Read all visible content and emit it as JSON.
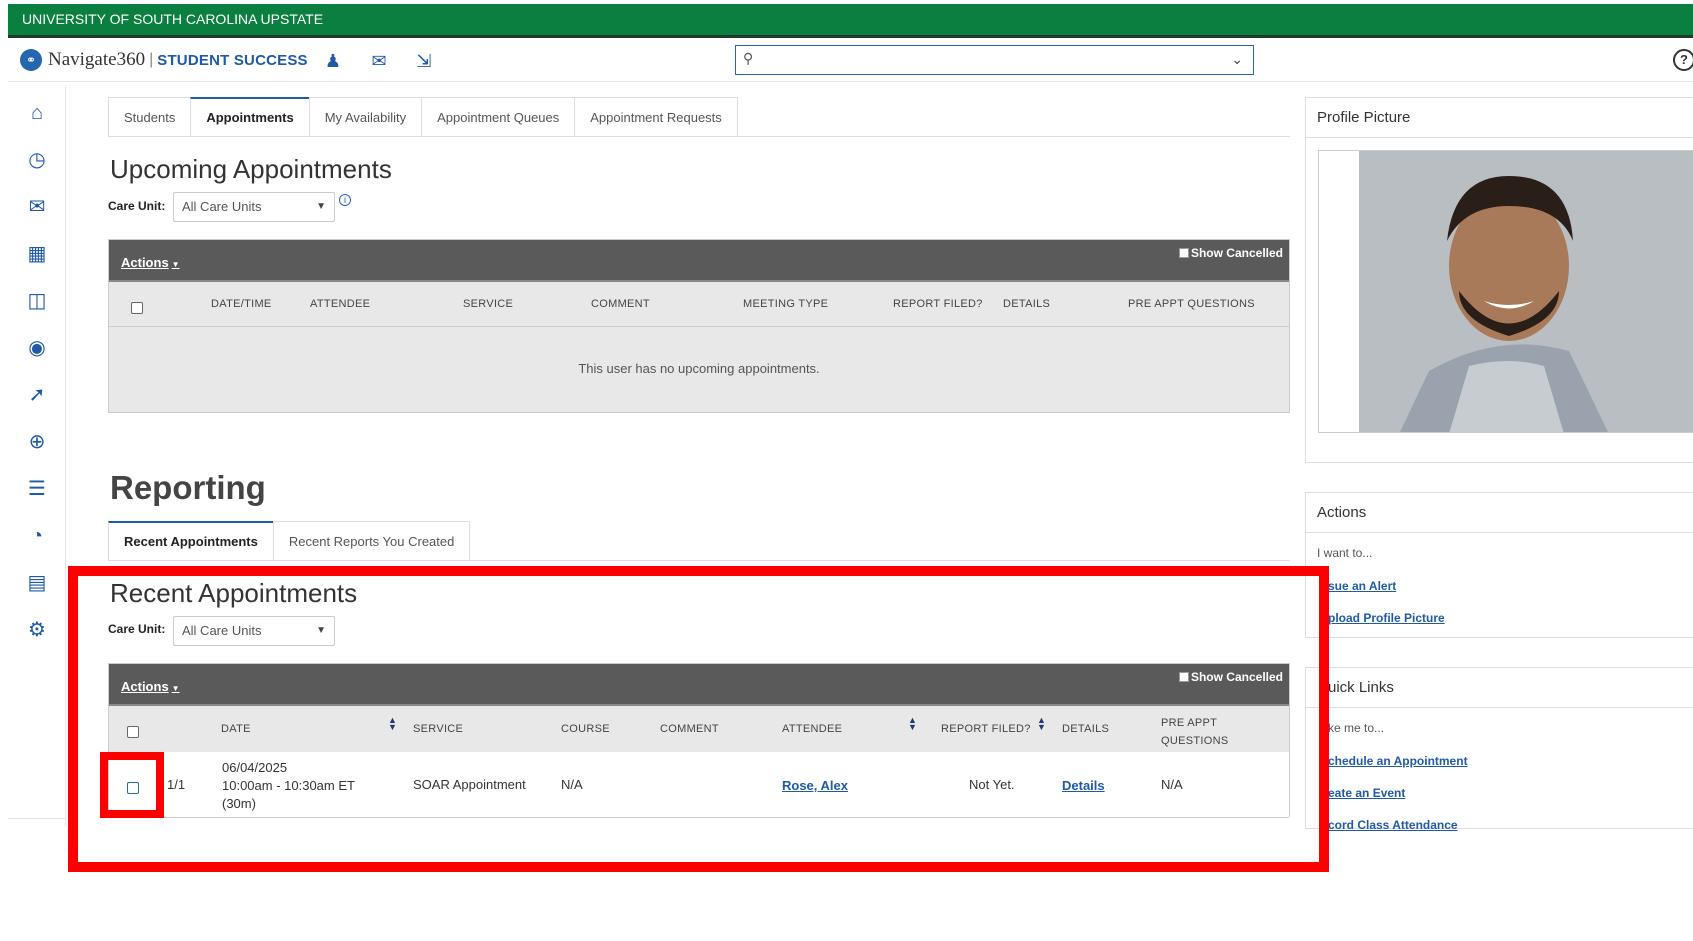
{
  "topbar": {
    "institution": "UNIVERSITY OF SOUTH CAROLINA UPSTATE"
  },
  "header": {
    "logo_name": "Navigate360",
    "logo_separator": "|",
    "logo_product": "STUDENT SUCCESS",
    "search_value": "",
    "help_label": "?"
  },
  "main_tabs": [
    {
      "label": "Students"
    },
    {
      "label": "Appointments",
      "active": true
    },
    {
      "label": "My Availability"
    },
    {
      "label": "Appointment Queues"
    },
    {
      "label": "Appointment Requests"
    }
  ],
  "upcoming": {
    "title": "Upcoming Appointments",
    "care_unit_label": "Care Unit:",
    "care_unit_value": "All Care Units",
    "actions_label": "Actions",
    "show_cancelled_label": "Show Cancelled",
    "columns": [
      "DATE/TIME",
      "ATTENDEE",
      "SERVICE",
      "COMMENT",
      "MEETING TYPE",
      "REPORT FILED?",
      "DETAILS",
      "PRE APPT QUESTIONS"
    ],
    "empty_message": "This user has no upcoming appointments."
  },
  "reporting": {
    "title": "Reporting",
    "tabs": [
      {
        "label": "Recent Appointments",
        "active": true
      },
      {
        "label": "Recent Reports You Created"
      }
    ]
  },
  "recent": {
    "title": "Recent Appointments",
    "care_unit_label": "Care Unit:",
    "care_unit_value": "All Care Units",
    "actions_label": "Actions",
    "show_cancelled_label": "Show Cancelled",
    "columns": {
      "date": "DATE",
      "service": "SERVICE",
      "course": "COURSE",
      "comment": "COMMENT",
      "attendee": "ATTENDEE",
      "report_filed": "REPORT FILED?",
      "details": "DETAILS",
      "pre_appt_1": "PRE APPT",
      "pre_appt_2": "QUESTIONS"
    },
    "rows": [
      {
        "index": "1/1",
        "date": "06/04/2025",
        "time": "10:00am - 10:30am ET",
        "duration": "(30m)",
        "service": "SOAR Appointment",
        "course": "N/A",
        "comment": "",
        "attendee": "Rose, Alex",
        "report_filed": "Not Yet.",
        "details": "Details",
        "pre_appt": "N/A"
      }
    ]
  },
  "profile_panel": {
    "title": "Profile Picture"
  },
  "actions_panel": {
    "title": "Actions",
    "subtitle": "I want to...",
    "links": [
      "sue an Alert",
      "pload Profile Picture"
    ]
  },
  "quick_links_panel": {
    "title": "uick Links",
    "subtitle": "ke me to...",
    "links": [
      "chedule an Appointment",
      "eate an Event",
      "cord Class Attendance"
    ]
  }
}
